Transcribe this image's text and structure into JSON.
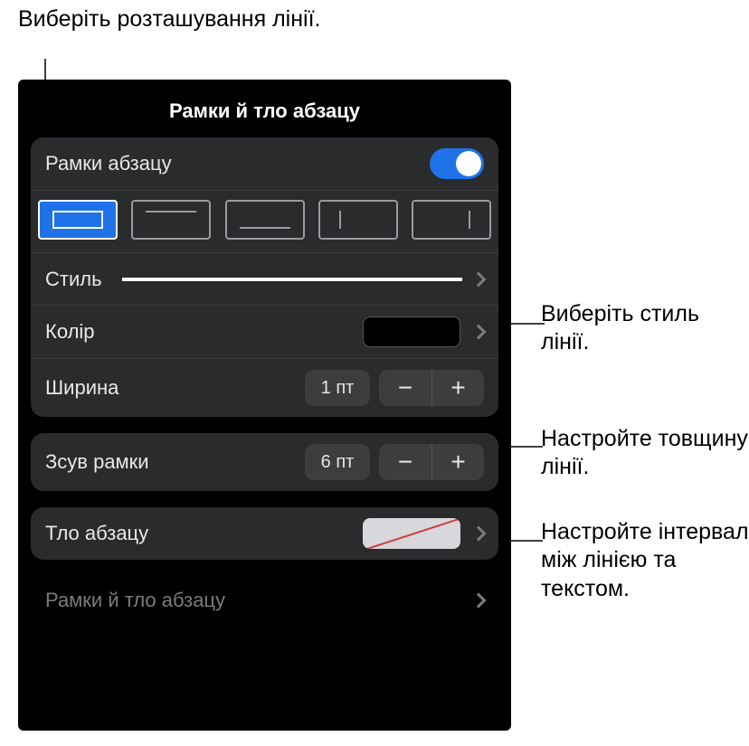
{
  "callouts": {
    "pos": "Виберіть розташування лінії.",
    "style": "Виберіть стиль лінії.",
    "width": "Настройте товщину лінії.",
    "offset": "Настройте інтервал між лінією та текстом."
  },
  "panel": {
    "title": "Рамки й тло абзацу",
    "borders_toggle_label": "Рамки абзацу",
    "style_label": "Стиль",
    "color_label": "Колір",
    "width_label": "Ширина",
    "width_value": "1 пт",
    "offset_label": "Зсув рамки",
    "offset_value": "6 пт",
    "bg_label": "Тло абзацу",
    "ghost_label": "Рамки й тло абзацу",
    "stepper_minus": "−",
    "stepper_plus": "+"
  }
}
